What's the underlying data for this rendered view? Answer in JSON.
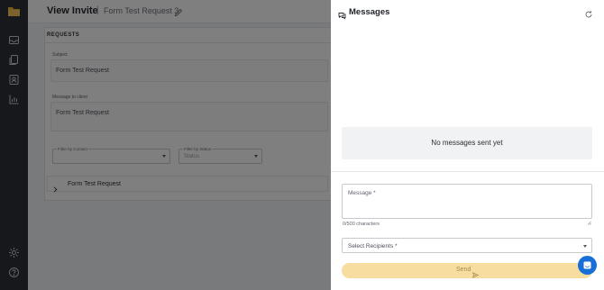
{
  "header": {
    "title": "View Invite",
    "separator": "|",
    "breadcrumb": "Form Test Request 3"
  },
  "section": {
    "heading": "REQUESTS"
  },
  "form": {
    "subject_label": "Subject",
    "subject_value": "Form Test Request",
    "message_label": "Message to client",
    "message_value": "Form Test Request",
    "filter_contact_label": "Filter by Contact",
    "filter_contact_value": "",
    "filter_status_label": "Filter by Status",
    "filter_status_value": "Status"
  },
  "request_list": [
    {
      "label": "Form Test Request"
    }
  ],
  "nav": {
    "icons": [
      "logo-icon",
      "inbox-icon",
      "documents-icon",
      "contacts-icon",
      "reports-icon",
      "settings-icon",
      "help-icon"
    ]
  },
  "panel": {
    "title": "Messages",
    "empty_text": "No messages sent yet",
    "message_placeholder": "Message *",
    "char_count": "0/500 characters",
    "recipients_placeholder": "Select Recipients *",
    "send_label": "Send"
  },
  "colors": {
    "rail": "#2c3038",
    "send_button": "#f8dda0",
    "chat_launcher": "#1a6fd6"
  }
}
